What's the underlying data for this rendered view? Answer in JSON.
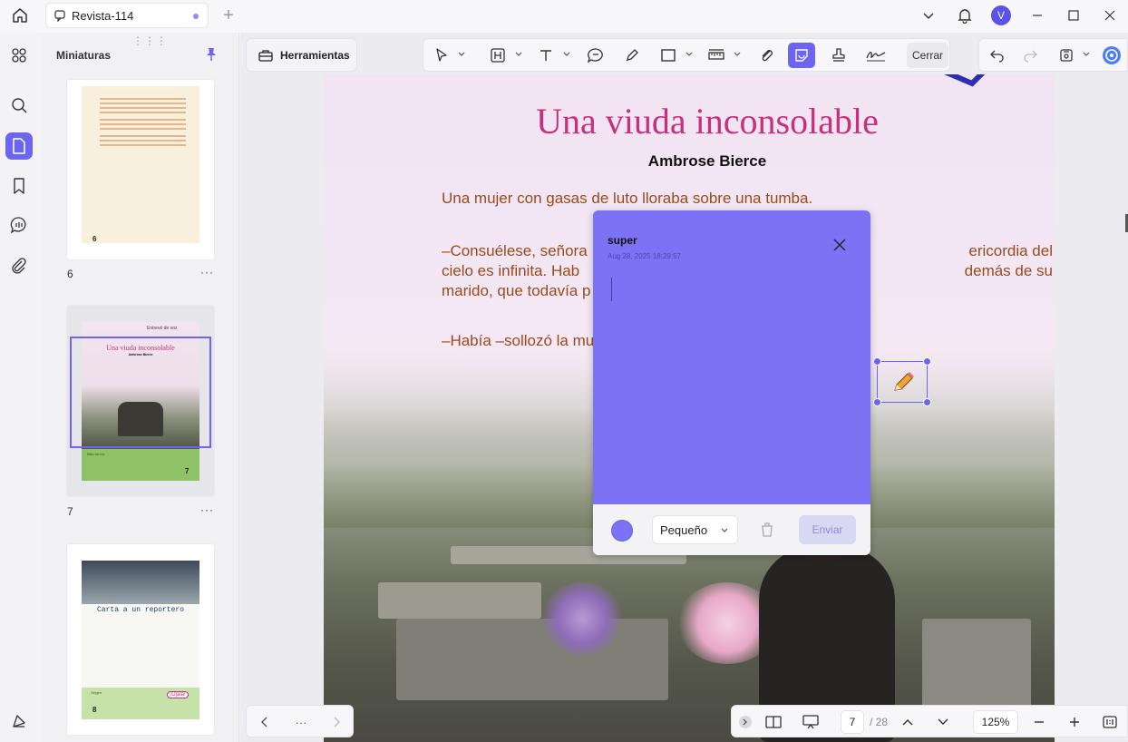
{
  "window": {
    "tab_title": "Revista-114",
    "new_tab_symbol": "+",
    "avatar_letter": "V"
  },
  "sidebar_rail": {
    "items": [
      {
        "icon": "grid-icon"
      },
      {
        "icon": "search-icon"
      },
      {
        "icon": "page-icon",
        "active": true
      },
      {
        "icon": "bookmark-icon"
      },
      {
        "icon": "comment-icon"
      },
      {
        "icon": "attachment-icon"
      }
    ],
    "bottom_icon": "layers-icon"
  },
  "thumbnails": {
    "title": "Miniaturas",
    "pages": [
      {
        "label": "6",
        "more": "···",
        "page_no": "6"
      },
      {
        "label": "7",
        "more": "···",
        "page_no": "7",
        "mini_title": "Una viuda inconsolable",
        "mini_author": "Ambrose Bierce",
        "mini_top": "Entrevé de voz",
        "mini_box": "Bilio de los"
      },
      {
        "label": "",
        "more": "···",
        "page_no": "8",
        "mini_title": "Carta a un reportero",
        "mini_badge": "¡Ojalá!",
        "mini_box": "Origen"
      }
    ]
  },
  "toolbar": {
    "tools_label": "Herramientas",
    "close_label": "Cerrar"
  },
  "document": {
    "title": "Una viuda inconsolable",
    "author": "Ambrose Bierce",
    "para1": "Una mujer con gasas de luto lloraba sobre una tumba.",
    "para2_left": "–Consuélese, señora",
    "para2_right": "ericordia del",
    "para2_l2_left": "cielo es infinita. Hab",
    "para2_l2_right": "demás de su",
    "para2_l3": "marido, que todavía p",
    "para3": "–Había –sollozó la mu"
  },
  "comment": {
    "user": "super",
    "timestamp": "Aug 28, 2025 18:29:57",
    "size_value": "Pequeño",
    "send_label": "Enviar",
    "color": "#7b72f4"
  },
  "navigation": {
    "more": "···",
    "current_page": "7",
    "total_pages": "/ 28",
    "zoom": "125%"
  }
}
